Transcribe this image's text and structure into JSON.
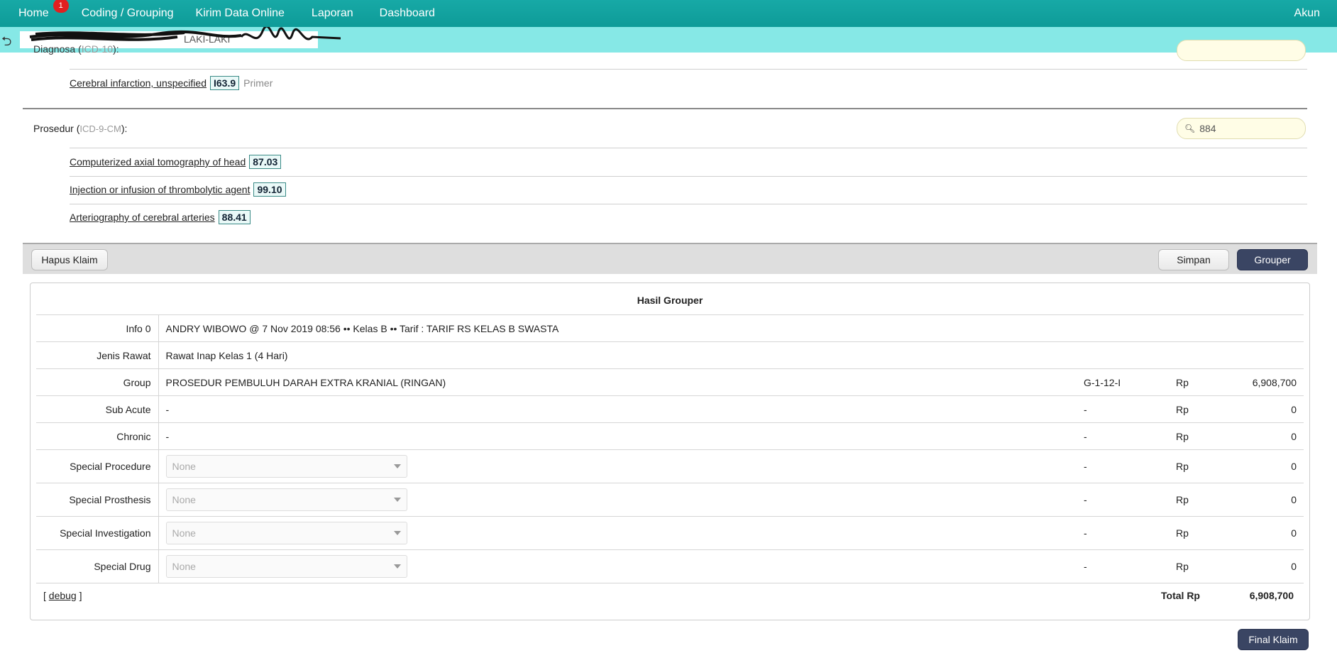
{
  "nav": {
    "items": [
      {
        "label": "Home",
        "badge": "1"
      },
      {
        "label": "Coding / Grouping"
      },
      {
        "label": "Kirim Data Online"
      },
      {
        "label": "Laporan"
      },
      {
        "label": "Dashboard"
      }
    ],
    "account": "Akun"
  },
  "patient": {
    "gender": "LAKI-LAKI"
  },
  "diagnosa": {
    "label": "Diagnosa",
    "code_system": "ICD-10",
    "items": [
      {
        "name": "Cerebral infarction, unspecified",
        "code": "I63.9",
        "type": "Primer"
      }
    ]
  },
  "prosedur": {
    "label": "Prosedur",
    "code_system": "ICD-9-CM",
    "search_value": "884",
    "items": [
      {
        "name": "Computerized axial tomography of head",
        "code": "87.03"
      },
      {
        "name": "Injection or infusion of thrombolytic agent",
        "code": "99.10"
      },
      {
        "name": "Arteriography of cerebral arteries",
        "code": "88.41"
      }
    ]
  },
  "actions": {
    "hapus": "Hapus Klaim",
    "simpan": "Simpan",
    "grouper": "Grouper",
    "final": "Final Klaim"
  },
  "hasil": {
    "title": "Hasil Grouper",
    "rows": [
      {
        "label": "Info 0",
        "value": "ANDRY WIBOWO @ 7 Nov 2019 08:56 •• Kelas B •• Tarif : TARIF RS KELAS B SWASTA"
      },
      {
        "label": "Jenis Rawat",
        "value": "Rawat Inap Kelas 1 (4 Hari)"
      },
      {
        "label": "Group",
        "value": "PROSEDUR PEMBULUH DARAH EXTRA KRANIAL (RINGAN)",
        "code": "G-1-12-I",
        "rp": "Rp",
        "amount": "6,908,700"
      },
      {
        "label": "Sub Acute",
        "value": "-",
        "code": "-",
        "rp": "Rp",
        "amount": "0"
      },
      {
        "label": "Chronic",
        "value": "-",
        "code": "-",
        "rp": "Rp",
        "amount": "0"
      }
    ],
    "special": [
      {
        "label": "Special Procedure",
        "selected": "None",
        "code": "-",
        "rp": "Rp",
        "amount": "0"
      },
      {
        "label": "Special Prosthesis",
        "selected": "None",
        "code": "-",
        "rp": "Rp",
        "amount": "0"
      },
      {
        "label": "Special Investigation",
        "selected": "None",
        "code": "-",
        "rp": "Rp",
        "amount": "0"
      },
      {
        "label": "Special Drug",
        "selected": "None",
        "code": "-",
        "rp": "Rp",
        "amount": "0"
      }
    ],
    "debug_open": "[",
    "debug_label": "debug",
    "debug_close": "]",
    "total_label": "Total Rp",
    "total_amount": "6,908,700"
  }
}
